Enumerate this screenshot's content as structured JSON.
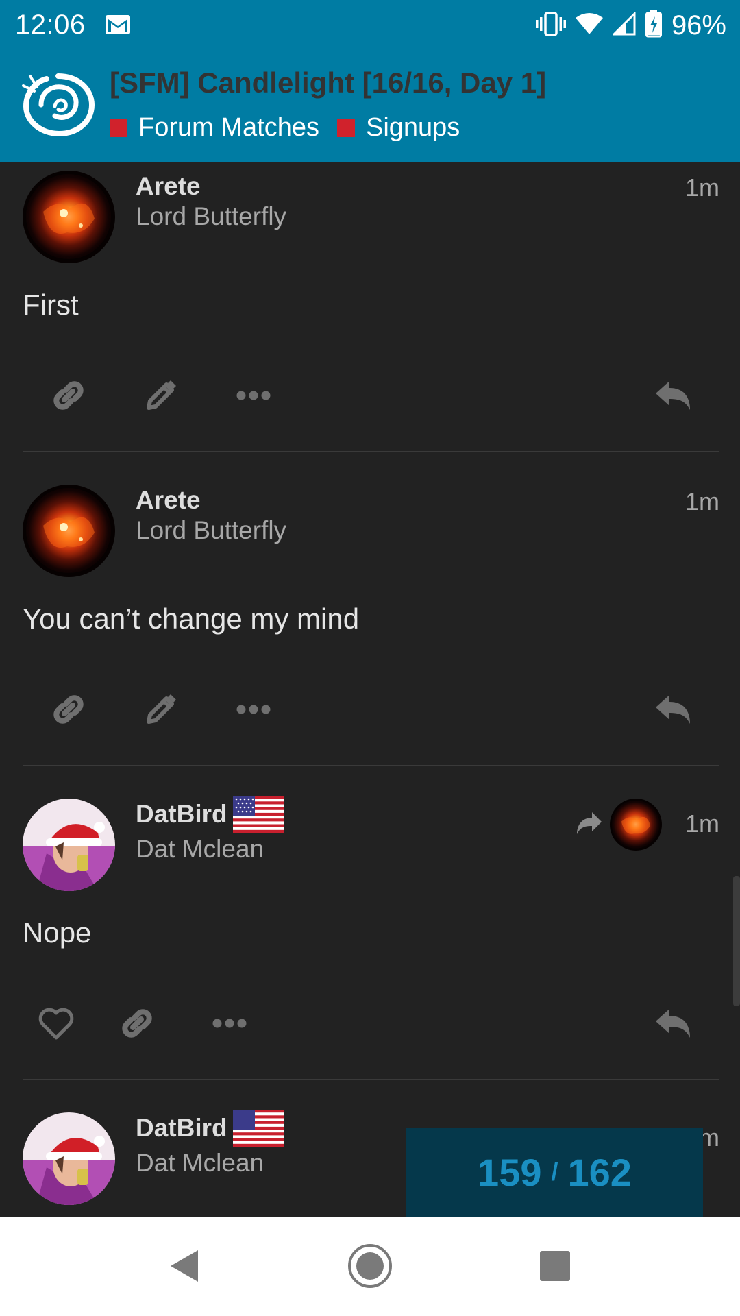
{
  "status_bar": {
    "time": "12:06",
    "battery": "96%",
    "icons": [
      "gmail-icon",
      "vibrate-icon",
      "wifi-icon",
      "signal-icon",
      "battery-charging-icon"
    ]
  },
  "topic": {
    "title": "[SFM] Candlelight [16/16, Day 1]",
    "categories": [
      {
        "label": "Forum Matches",
        "color": "#d0222c"
      },
      {
        "label": "Signups",
        "color": "#d0222c"
      }
    ]
  },
  "posts": [
    {
      "username": "Arete",
      "full_name": "Lord Butterfly",
      "age": "1m",
      "body": "First",
      "actions": [
        "link-icon",
        "edit-icon",
        "more-icon",
        "reply-icon"
      ]
    },
    {
      "username": "Arete",
      "full_name": "Lord Butterfly",
      "age": "1m",
      "body": "You can’t change my mind",
      "actions": [
        "link-icon",
        "edit-icon",
        "more-icon",
        "reply-icon"
      ]
    },
    {
      "username": "DatBird",
      "full_name": "Dat Mclean",
      "age": "1m",
      "body": "Nope",
      "actions": [
        "like-icon",
        "link-icon",
        "more-icon",
        "reply-icon"
      ]
    },
    {
      "username": "DatBird",
      "full_name": "Dat Mclean",
      "age": "1m"
    }
  ],
  "progress": {
    "current": "159",
    "separator": "/",
    "total": "162"
  },
  "colors": {
    "header": "#007ca3",
    "background": "#222222",
    "category": "#d0222c",
    "progress_text": "#1a8fc2"
  }
}
